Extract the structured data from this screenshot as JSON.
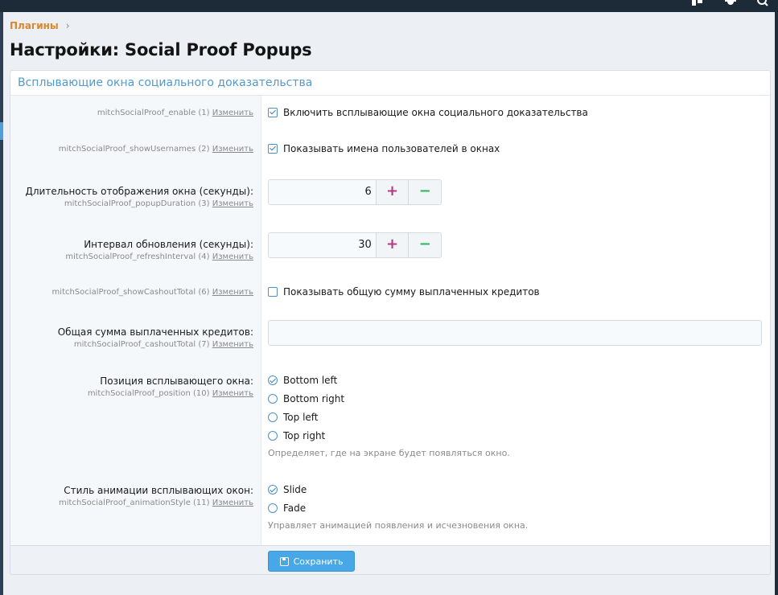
{
  "breadcrumb": {
    "item": "Плагины",
    "separator": "›"
  },
  "page_title": "Настройки: Social Proof Popups",
  "block_title": "Всплывающие окна социального доказательства",
  "change_label": "Изменить",
  "options": {
    "enable": {
      "meta": "mitchSocialProof_enable (1)",
      "label": "Включить всплывающие окна социального доказательства",
      "checked": true
    },
    "show_usernames": {
      "meta": "mitchSocialProof_showUsernames (2)",
      "label": "Показывать имена пользователей в окнах",
      "checked": true
    },
    "popup_duration": {
      "title": "Длительность отображения окна (секунды):",
      "meta": "mitchSocialProof_popupDuration (3)",
      "value": "6"
    },
    "refresh_interval": {
      "title": "Интервал обновления (секунды):",
      "meta": "mitchSocialProof_refreshInterval (4)",
      "value": "30"
    },
    "show_cashout_total": {
      "meta": "mitchSocialProof_showCashoutTotal (6)",
      "label": "Показывать общую сумму выплаченных кредитов",
      "checked": false
    },
    "cashout_total": {
      "title": "Общая сумма выплаченных кредитов:",
      "meta": "mitchSocialProof_cashoutTotal (7)",
      "value": ""
    },
    "position": {
      "title": "Позиция всплывающего окна:",
      "meta": "mitchSocialProof_position (10)",
      "choices": [
        "Bottom left",
        "Bottom right",
        "Top left",
        "Top right"
      ],
      "selected": "Bottom left",
      "hint": "Определяет, где на экране будет появляться окно."
    },
    "animation_style": {
      "title": "Стиль анимации всплывающих окон:",
      "meta": "mitchSocialProof_animationStyle (11)",
      "choices": [
        "Slide",
        "Fade"
      ],
      "selected": "Slide",
      "hint": "Управляет анимацией появления и исчезновения окна."
    }
  },
  "spinner": {
    "plus": "+",
    "minus": "−"
  },
  "save_label": "Сохранить",
  "colors": {
    "accent": "#48a7e6",
    "breadcrumb": "#d9882f",
    "block_title": "#4f9bd0",
    "plus": "#b23a7e",
    "minus": "#2eb85c"
  },
  "icons": {
    "top1": "sitemap-icon",
    "top2": "gear-icon",
    "top3": "search-icon",
    "save": "save-icon"
  }
}
